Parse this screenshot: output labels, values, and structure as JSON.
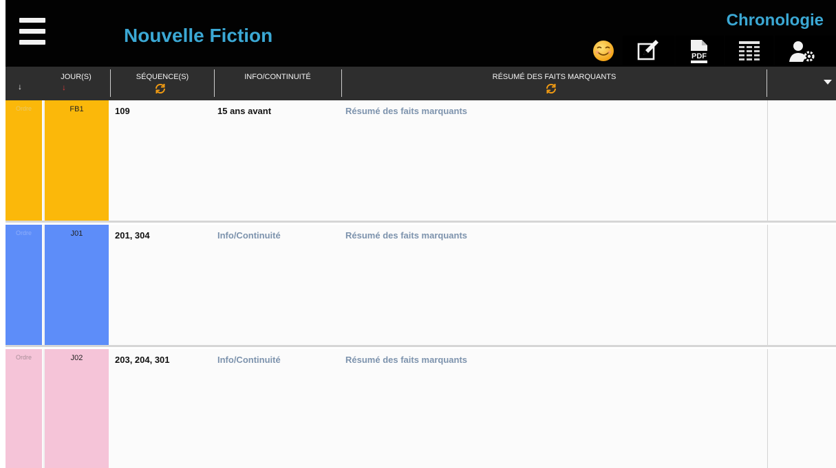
{
  "app": {
    "title": "Nouvelle Fiction",
    "module": "Chronologie"
  },
  "toolbar": {
    "menu_icon": "hamburger-menu-icon",
    "emoji_icon": "smiley-emoji-icon",
    "edit_icon": "edit-note-icon",
    "pdf_icon": "pdf-document-icon",
    "pdf_label": "PDF",
    "list_icon": "table-list-icon",
    "user_settings_icon": "user-settings-icon"
  },
  "header": {
    "columns": [
      {
        "label": "",
        "icon": "sort-down-arrow-icon"
      },
      {
        "label": "JOUR(S)",
        "icon": "sort-down-arrow-red-icon"
      },
      {
        "label": "SÉQUENCE(S)",
        "icon": "refresh-icon"
      },
      {
        "label": "INFO/CONTINUITÉ",
        "icon": ""
      },
      {
        "label": "RÉSUMÉ DES FAITS MARQUANTS",
        "icon": "refresh-icon"
      },
      {
        "label": "",
        "icon": "dropdown-triangle-icon"
      }
    ]
  },
  "rows": [
    {
      "ordre": "Ordre",
      "jour": "FB1",
      "sequences": "109",
      "info": "15 ans avant",
      "info_is_placeholder": false,
      "resume": "Résumé des faits marquants",
      "color": "#fbb80a",
      "ordre_text_color": "#e8c86a"
    },
    {
      "ordre": "Ordre",
      "jour": "J01",
      "sequences": "201, 304",
      "info": "Info/Continuité",
      "info_is_placeholder": true,
      "resume": "Résumé des faits marquants",
      "color": "#5d8df9",
      "ordre_text_color": "#8eaefb"
    },
    {
      "ordre": "Ordre",
      "jour": "J02",
      "sequences": "203, 204, 301",
      "info": "Info/Continuité",
      "info_is_placeholder": true,
      "resume": "Résumé des faits marquants",
      "color": "#f5c4d8",
      "ordre_text_color": "#a98d98"
    }
  ],
  "colors": {
    "accent": "#3ba8d4",
    "topbar": "#020202",
    "header": "#2e2e2e",
    "placeholder_text": "#7d93ad",
    "sync_orange": "#f39c12"
  }
}
